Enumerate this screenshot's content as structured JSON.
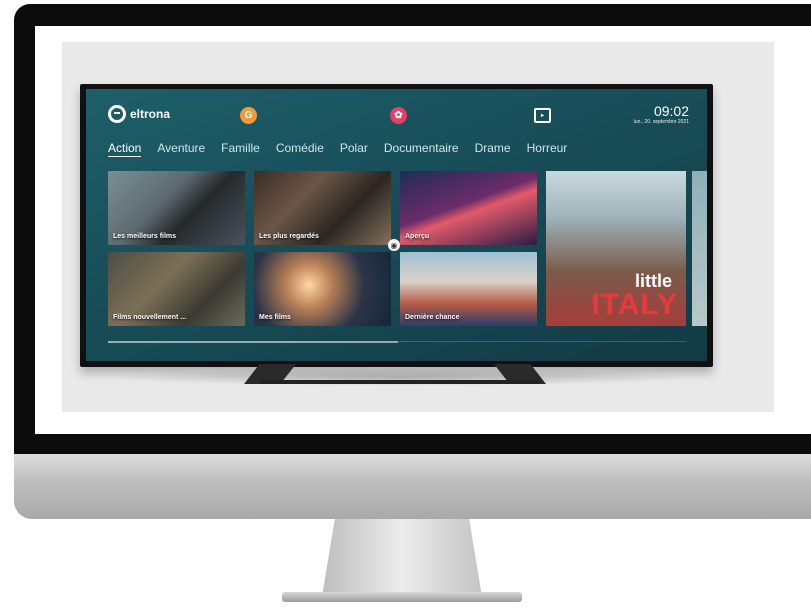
{
  "brand": {
    "name": "eltrona"
  },
  "clock": {
    "time": "09:02",
    "date": "lun., 20. septembre 2021"
  },
  "categories": [
    "Action",
    "Aventure",
    "Famille",
    "Comédie",
    "Polar",
    "Documentaire",
    "Drame",
    "Horreur"
  ],
  "active_category": "Action",
  "tiles": [
    {
      "label": "Les meilleurs films"
    },
    {
      "label": "Les plus regardés"
    },
    {
      "label": "Aperçu"
    },
    {
      "label": "Films nouvellement ..."
    },
    {
      "label": "Mes films"
    },
    {
      "label": "Dernière chance"
    }
  ],
  "featured": {
    "title_top": "little",
    "title_bottom": "ITALY"
  },
  "icons": {
    "logo": "eltrona-logo-icon",
    "google": "google-assistant-icon",
    "settings": "settings-icon",
    "input": "input-source-icon",
    "cast": "broadcast-icon"
  },
  "colors": {
    "accent_orange": "#f39a34",
    "accent_pink": "#e63f6b",
    "screen_teal": "#1d5f6a"
  }
}
